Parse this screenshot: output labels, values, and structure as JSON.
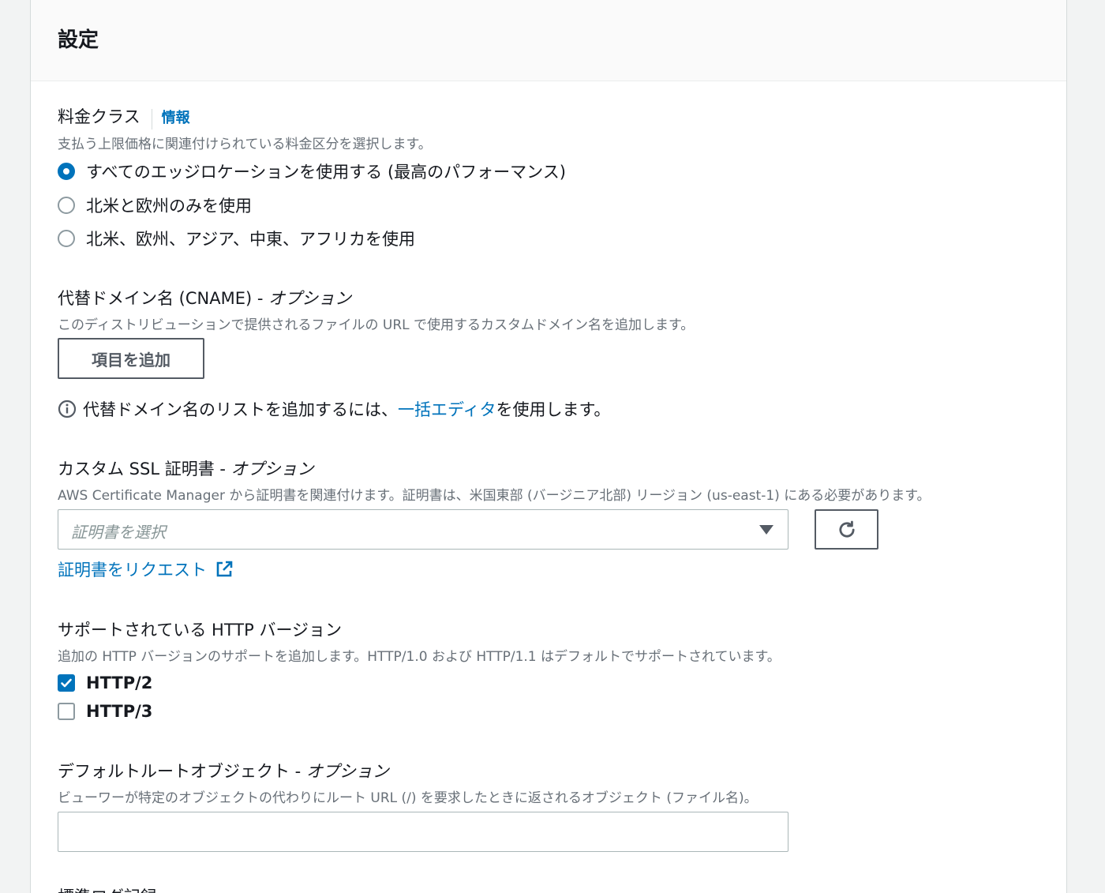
{
  "panel": {
    "title": "設定"
  },
  "price_class": {
    "label": "料金クラス",
    "info_link": "情報",
    "description": "支払う上限価格に関連付けられている料金区分を選択します。",
    "options": [
      {
        "label": "すべてのエッジロケーションを使用する (最高のパフォーマンス)",
        "selected": true
      },
      {
        "label": "北米と欧州のみを使用",
        "selected": false
      },
      {
        "label": "北米、欧州、アジア、中東、アフリカを使用",
        "selected": false
      }
    ]
  },
  "cname": {
    "label": "代替ドメイン名 (CNAME) - ",
    "label_optional": "オプション",
    "description": "このディストリビューションで提供されるファイルの URL で使用するカスタムドメイン名を追加します。",
    "add_button": "項目を追加",
    "hint_prefix": "代替ドメイン名のリストを追加するには、",
    "hint_link": "一括エディタ",
    "hint_suffix": " を使用します。"
  },
  "ssl": {
    "label": "カスタム SSL 証明書 - ",
    "label_optional": "オプション",
    "description": "AWS Certificate Manager から証明書を関連付けます。証明書は、米国東部 (バージニア北部) リージョン (us-east-1) にある必要があります。",
    "select_placeholder": "証明書を選択",
    "request_link": "証明書をリクエスト"
  },
  "http_versions": {
    "label": "サポートされている HTTP バージョン",
    "description": "追加の HTTP バージョンのサポートを追加します。HTTP/1.0 および HTTP/1.1 はデフォルトでサポートされています。",
    "options": [
      {
        "label": "HTTP/2",
        "checked": true
      },
      {
        "label": "HTTP/3",
        "checked": false
      }
    ]
  },
  "default_root": {
    "label": "デフォルトルートオブジェクト - ",
    "label_optional": "オプション",
    "description": "ビューワーが特定のオブジェクトの代わりにルート URL (/) を要求したときに返されるオブジェクト (ファイル名)。",
    "value": ""
  },
  "next_section": {
    "label": "標準ログ記録"
  },
  "colors": {
    "accent": "#0073bb",
    "text": "#16191f",
    "muted": "#687078"
  }
}
